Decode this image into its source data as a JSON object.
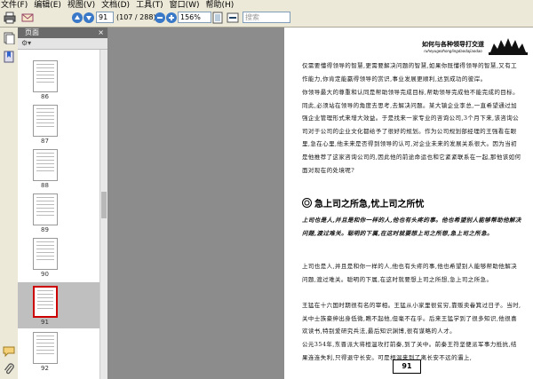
{
  "menu": [
    "文件(F)",
    "编辑(E)",
    "视图(V)",
    "文档(D)",
    "工具(T)",
    "窗口(W)",
    "帮助(H)"
  ],
  "toolbar": {
    "page_input": "91",
    "page_total": "(107 / 288)",
    "zoom": "156%",
    "search_placeholder": "搜索"
  },
  "panel": {
    "title": "页面"
  },
  "thumbnails": [
    "86",
    "87",
    "88",
    "89",
    "90",
    "91",
    "92"
  ],
  "document": {
    "running_head": "如何与各种领导打交道",
    "running_head_sub": "ruheyugezhonglingdaodajiaodao",
    "para1": "仅需要懂得领导的智慧,更需要解决问题的智慧,如果你既懂得领导的智慧,又有工作能力,你肯定能赢得领导的赏识,事业发展更顺利,达到成功的彼岸。",
    "para2": "你领导最大的尊重和认同是帮助领导完成目标,帮助领导完成他不能完成的目标。同此,必须站在领导的角度去思考,去解决问题。某大镇企业李总,一直希望通过加强企业管理形式来增大效益。于是找来一家专业的咨询公司,3个月下来,该咨询公司对于公司的企业文化都给予了很好的规划。作为公司规划部经理的王强看在眼里,急在心里,他未来是否得到领导的认可,对企业未来的发展关系很大。因为当初是他推荐了这家咨询公司的,因此他的前途命运也和它紧紧联系在一起,那他该如何面对现在的处境呢?",
    "heading": "急上司之所急,忧上司之所忧",
    "intro": "上司也是人,并且是和你一样的人,他也有头疼的事。他也希望别人能够帮助他解决问题,渡过难关。聪明的下属,在这时就要想上司之所想,急上司之所急。",
    "para3": "上司也是人,并且是和你一样的人,他也有头疼的事,他也希望别人能够帮助他解决问题,渡过难关。聪明的下属,在这时就要想上司之所想,急上司之所急。",
    "para4": "王猛在十六国时期很有名的宰相。王猛从小家里很贫穷,靠贩卖畚箕过日子。当时,关中士族豪绅出身低微,瞧不起他,但毫不在乎。后来王猛学到了很多知识,他很喜欢读书,特别爱研究兵法,最后知识渊博,很有谋略的人才。",
    "para5": "公元354年,东晋派大将桓温攻打前秦,到了关中。前秦王符坚便派军事力抵抗,结果连连失利,只得退守长安。可是桓温来到了离长安不远的灞上,",
    "page_number": "91"
  }
}
